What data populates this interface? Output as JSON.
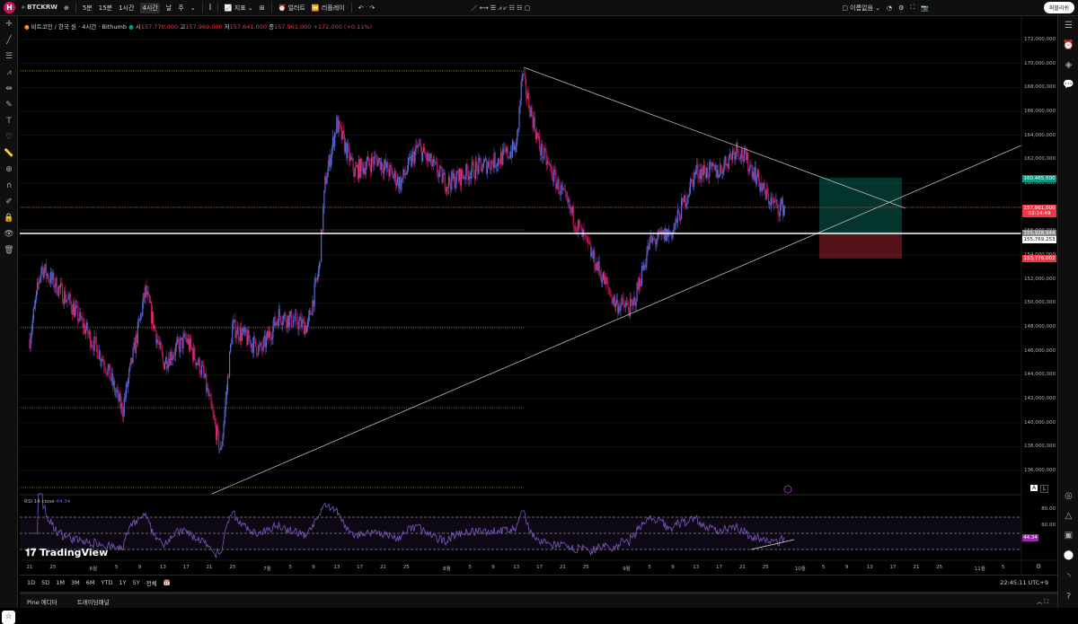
{
  "toolbar": {
    "symbol": "BTCKRW",
    "intervals": [
      "5분",
      "15분",
      "1시간",
      "4시간",
      "날",
      "주"
    ],
    "active_interval": "4시간",
    "indicators": "지표",
    "alert": "얼러트",
    "replay": "리플레이",
    "layout_name": "이름없음",
    "refresh": "퍼블리쉬"
  },
  "legend": {
    "title": "비트코인 / 한국 원 · 4시간 · Bithumb",
    "o_label": "시",
    "o": "157,770,000",
    "h_label": "고",
    "h": "157,969,000",
    "l_label": "저",
    "l": "157,641,000",
    "c_label": "종",
    "c": "157,961,000",
    "change": "+172,000 (+0.11%)"
  },
  "price_axis": [
    "172,000,000",
    "170,000,000",
    "168,000,000",
    "166,000,000",
    "164,000,000",
    "162,000,000",
    "160,000,000",
    "158,000,000",
    "156,000,000",
    "154,000,000",
    "152,000,000",
    "150,000,000",
    "148,000,000",
    "146,000,000",
    "144,000,000",
    "142,000,000",
    "140,000,000",
    "138,000,000",
    "136,000,000"
  ],
  "price_tags": {
    "target": "160,465,500",
    "last": "157,961,000",
    "countdown": "02:14:49",
    "entry": "155,928,944",
    "hline": "155,769,253",
    "stop": "153,776,002"
  },
  "rsi": {
    "label": "RSI 14 close",
    "value": "44.34",
    "levels": [
      "80.00",
      "60.00"
    ]
  },
  "time_axis": [
    [
      "21",
      0
    ],
    [
      "25",
      4
    ],
    [
      "6월",
      11
    ],
    [
      "5",
      15
    ],
    [
      "9",
      19
    ],
    [
      "13",
      23
    ],
    [
      "17",
      27
    ],
    [
      "21",
      31
    ],
    [
      "25",
      35
    ],
    [
      "7월",
      41
    ],
    [
      "5",
      45
    ],
    [
      "9",
      49
    ],
    [
      "13",
      53
    ],
    [
      "17",
      57
    ],
    [
      "21",
      61
    ],
    [
      "25",
      65
    ],
    [
      "8월",
      72
    ],
    [
      "5",
      76
    ],
    [
      "9",
      80
    ],
    [
      "13",
      84
    ],
    [
      "17",
      88
    ],
    [
      "21",
      92
    ],
    [
      "25",
      96
    ],
    [
      "9월",
      103
    ],
    [
      "5",
      107
    ],
    [
      "9",
      111
    ],
    [
      "13",
      115
    ],
    [
      "17",
      119
    ],
    [
      "21",
      123
    ],
    [
      "25",
      127
    ],
    [
      "10월",
      133
    ],
    [
      "5",
      137
    ],
    [
      "9",
      141
    ],
    [
      "13",
      145
    ],
    [
      "17",
      149
    ],
    [
      "21",
      153
    ],
    [
      "25",
      157
    ],
    [
      "11월",
      164
    ],
    [
      "5",
      168
    ]
  ],
  "range_buttons": [
    "1D",
    "5D",
    "1M",
    "3M",
    "6M",
    "YTD",
    "1Y",
    "5Y",
    "전체"
  ],
  "clock": "22:45:11 UTC+9",
  "bottom_tabs": [
    "Pine 에디터",
    "트레이딩패널"
  ],
  "brand": "TradingView",
  "colors": {
    "up": "#5b6bd6",
    "down": "#c2185b",
    "long": "#089981",
    "short": "#f23645",
    "rsi": "#7e57c2"
  },
  "chart_data": {
    "type": "candlestick",
    "symbol": "BTCKRW",
    "interval": "4h",
    "ylim": [
      135000000,
      173000000
    ],
    "close_path": [
      [
        0,
        147
      ],
      [
        2,
        153
      ],
      [
        7,
        150
      ],
      [
        13,
        145
      ],
      [
        16,
        141
      ],
      [
        20,
        151
      ],
      [
        23,
        145
      ],
      [
        27,
        147
      ],
      [
        30,
        144
      ],
      [
        33,
        137.5
      ],
      [
        35,
        148
      ],
      [
        40,
        146
      ],
      [
        43,
        149
      ],
      [
        48,
        148
      ],
      [
        50,
        153
      ],
      [
        51,
        160
      ],
      [
        53,
        165
      ],
      [
        56,
        161
      ],
      [
        60,
        162
      ],
      [
        64,
        160
      ],
      [
        67,
        163
      ],
      [
        72,
        160
      ],
      [
        76,
        161
      ],
      [
        81,
        162
      ],
      [
        84,
        163
      ],
      [
        85,
        169
      ],
      [
        88,
        163
      ],
      [
        91,
        160
      ],
      [
        94,
        157
      ],
      [
        96,
        155
      ],
      [
        101,
        150
      ],
      [
        104,
        149.5
      ],
      [
        107,
        155
      ],
      [
        111,
        156
      ],
      [
        115,
        161
      ],
      [
        119,
        161
      ],
      [
        122,
        163
      ],
      [
        125,
        161
      ],
      [
        127,
        159
      ],
      [
        129,
        158
      ],
      [
        130.5,
        158
      ]
    ]
  }
}
